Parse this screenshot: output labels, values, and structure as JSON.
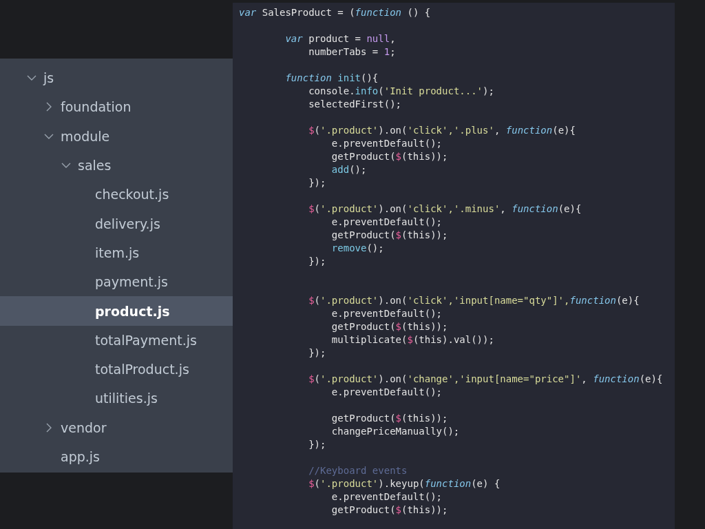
{
  "file_tree": [
    {
      "kind": "folder",
      "name": "js",
      "expanded": true,
      "selected": false,
      "children": [
        {
          "kind": "folder",
          "name": "foundation",
          "expanded": false,
          "selected": false
        },
        {
          "kind": "folder",
          "name": "module",
          "expanded": true,
          "selected": false,
          "children": [
            {
              "kind": "folder",
              "name": "sales",
              "expanded": true,
              "selected": false,
              "children": [
                {
                  "kind": "file",
                  "name": "checkout.js",
                  "selected": false
                },
                {
                  "kind": "file",
                  "name": "delivery.js",
                  "selected": false
                },
                {
                  "kind": "file",
                  "name": "item.js",
                  "selected": false
                },
                {
                  "kind": "file",
                  "name": "payment.js",
                  "selected": false
                },
                {
                  "kind": "file",
                  "name": "product.js",
                  "selected": true
                },
                {
                  "kind": "file",
                  "name": "totalPayment.js",
                  "selected": false
                },
                {
                  "kind": "file",
                  "name": "totalProduct.js",
                  "selected": false
                },
                {
                  "kind": "file",
                  "name": "utilities.js",
                  "selected": false
                }
              ]
            }
          ]
        },
        {
          "kind": "folder",
          "name": "vendor",
          "expanded": false,
          "selected": false
        },
        {
          "kind": "file",
          "name": "app.js",
          "selected": false
        }
      ]
    }
  ],
  "code_lines": [
    {
      "kind": "code",
      "tokens": [
        {
          "kind": "keyword",
          "text": "var"
        },
        {
          "kind": "plain",
          "text": " SalesProduct = ("
        },
        {
          "kind": "keyword",
          "text": "function"
        },
        {
          "kind": "plain",
          "text": " () {"
        }
      ]
    },
    {
      "kind": "blank"
    },
    {
      "kind": "code",
      "tokens": [
        {
          "kind": "keyword",
          "text": "        var"
        },
        {
          "kind": "plain",
          "text": " product = "
        },
        {
          "kind": "literal",
          "text": "null"
        },
        {
          "kind": "plain",
          "text": ","
        }
      ]
    },
    {
      "kind": "code",
      "tokens": [
        {
          "kind": "plain",
          "text": "            numberTabs = "
        },
        {
          "kind": "literal",
          "text": "1"
        },
        {
          "kind": "plain",
          "text": ";"
        }
      ]
    },
    {
      "kind": "blank"
    },
    {
      "kind": "code",
      "tokens": [
        {
          "kind": "keyword",
          "text": "        function"
        },
        {
          "kind": "call",
          "text": " init"
        },
        {
          "kind": "plain",
          "text": "(){"
        }
      ]
    },
    {
      "kind": "code",
      "tokens": [
        {
          "kind": "plain",
          "text": "            console."
        },
        {
          "kind": "call",
          "text": "info"
        },
        {
          "kind": "plain",
          "text": "("
        },
        {
          "kind": "string",
          "text": "'Init product...'"
        },
        {
          "kind": "plain",
          "text": ");"
        }
      ]
    },
    {
      "kind": "code",
      "tokens": [
        {
          "kind": "plain",
          "text": "            selectedFirst();"
        }
      ]
    },
    {
      "kind": "blank"
    },
    {
      "kind": "code",
      "tokens": [
        {
          "kind": "dollar",
          "text": "            $"
        },
        {
          "kind": "plain",
          "text": "("
        },
        {
          "kind": "string",
          "text": "'.product'"
        },
        {
          "kind": "plain",
          "text": ").on("
        },
        {
          "kind": "string",
          "text": "'click',"
        },
        {
          "kind": "string",
          "text": "'.plus'"
        },
        {
          "kind": "plain",
          "text": ", "
        },
        {
          "kind": "keyword",
          "text": "function"
        },
        {
          "kind": "plain",
          "text": "(e){"
        }
      ]
    },
    {
      "kind": "code",
      "tokens": [
        {
          "kind": "plain",
          "text": "                e.preventDefault();"
        }
      ]
    },
    {
      "kind": "code",
      "tokens": [
        {
          "kind": "plain",
          "text": "                getProduct("
        },
        {
          "kind": "dollar",
          "text": "$"
        },
        {
          "kind": "plain",
          "text": "(this));"
        }
      ]
    },
    {
      "kind": "code",
      "tokens": [
        {
          "kind": "call",
          "text": "                add"
        },
        {
          "kind": "plain",
          "text": "();"
        }
      ]
    },
    {
      "kind": "code",
      "tokens": [
        {
          "kind": "plain",
          "text": "            });"
        }
      ]
    },
    {
      "kind": "blank"
    },
    {
      "kind": "code",
      "tokens": [
        {
          "kind": "dollar",
          "text": "            $"
        },
        {
          "kind": "plain",
          "text": "("
        },
        {
          "kind": "string",
          "text": "'.product'"
        },
        {
          "kind": "plain",
          "text": ").on("
        },
        {
          "kind": "string",
          "text": "'click',"
        },
        {
          "kind": "string",
          "text": "'.minus'"
        },
        {
          "kind": "plain",
          "text": ", "
        },
        {
          "kind": "keyword",
          "text": "function"
        },
        {
          "kind": "plain",
          "text": "(e){"
        }
      ]
    },
    {
      "kind": "code",
      "tokens": [
        {
          "kind": "plain",
          "text": "                e.preventDefault();"
        }
      ]
    },
    {
      "kind": "code",
      "tokens": [
        {
          "kind": "plain",
          "text": "                getProduct("
        },
        {
          "kind": "dollar",
          "text": "$"
        },
        {
          "kind": "plain",
          "text": "(this));"
        }
      ]
    },
    {
      "kind": "code",
      "tokens": [
        {
          "kind": "call",
          "text": "                remove"
        },
        {
          "kind": "plain",
          "text": "();"
        }
      ]
    },
    {
      "kind": "code",
      "tokens": [
        {
          "kind": "plain",
          "text": "            });"
        }
      ]
    },
    {
      "kind": "blank"
    },
    {
      "kind": "blank"
    },
    {
      "kind": "code",
      "tokens": [
        {
          "kind": "dollar",
          "text": "            $"
        },
        {
          "kind": "plain",
          "text": "("
        },
        {
          "kind": "string",
          "text": "'.product'"
        },
        {
          "kind": "plain",
          "text": ").on("
        },
        {
          "kind": "string",
          "text": "'click',"
        },
        {
          "kind": "string",
          "text": "'input[name=\"qty\"]',"
        },
        {
          "kind": "keyword",
          "text": "function"
        },
        {
          "kind": "plain",
          "text": "(e){"
        }
      ]
    },
    {
      "kind": "code",
      "tokens": [
        {
          "kind": "plain",
          "text": "                e.preventDefault();"
        }
      ]
    },
    {
      "kind": "code",
      "tokens": [
        {
          "kind": "plain",
          "text": "                getProduct("
        },
        {
          "kind": "dollar",
          "text": "$"
        },
        {
          "kind": "plain",
          "text": "(this));"
        }
      ]
    },
    {
      "kind": "code",
      "tokens": [
        {
          "kind": "plain",
          "text": "                multiplicate("
        },
        {
          "kind": "dollar",
          "text": "$"
        },
        {
          "kind": "plain",
          "text": "(this).val());"
        }
      ]
    },
    {
      "kind": "code",
      "tokens": [
        {
          "kind": "plain",
          "text": "            });"
        }
      ]
    },
    {
      "kind": "blank"
    },
    {
      "kind": "code",
      "tokens": [
        {
          "kind": "dollar",
          "text": "            $"
        },
        {
          "kind": "plain",
          "text": "("
        },
        {
          "kind": "string",
          "text": "'.product'"
        },
        {
          "kind": "plain",
          "text": ").on("
        },
        {
          "kind": "string",
          "text": "'change',"
        },
        {
          "kind": "string",
          "text": "'input[name=\"price\"]'"
        },
        {
          "kind": "plain",
          "text": ", "
        },
        {
          "kind": "keyword",
          "text": "function"
        },
        {
          "kind": "plain",
          "text": "(e){"
        }
      ]
    },
    {
      "kind": "code",
      "tokens": [
        {
          "kind": "plain",
          "text": "                e.preventDefault();"
        }
      ]
    },
    {
      "kind": "blank"
    },
    {
      "kind": "code",
      "tokens": [
        {
          "kind": "plain",
          "text": "                getProduct("
        },
        {
          "kind": "dollar",
          "text": "$"
        },
        {
          "kind": "plain",
          "text": "(this));"
        }
      ]
    },
    {
      "kind": "code",
      "tokens": [
        {
          "kind": "plain",
          "text": "                changePriceManually();"
        }
      ]
    },
    {
      "kind": "code",
      "tokens": [
        {
          "kind": "plain",
          "text": "            });"
        }
      ]
    },
    {
      "kind": "blank"
    },
    {
      "kind": "code",
      "tokens": [
        {
          "kind": "comment",
          "text": "            //Keyboard events"
        }
      ]
    },
    {
      "kind": "code",
      "tokens": [
        {
          "kind": "dollar",
          "text": "            $"
        },
        {
          "kind": "plain",
          "text": "("
        },
        {
          "kind": "string",
          "text": "'.product'"
        },
        {
          "kind": "plain",
          "text": ").keyup("
        },
        {
          "kind": "keyword",
          "text": "function"
        },
        {
          "kind": "plain",
          "text": "(e) {"
        }
      ]
    },
    {
      "kind": "code",
      "tokens": [
        {
          "kind": "plain",
          "text": "                e.preventDefault();"
        }
      ]
    },
    {
      "kind": "code",
      "tokens": [
        {
          "kind": "plain",
          "text": "                getProduct("
        },
        {
          "kind": "dollar",
          "text": "$"
        },
        {
          "kind": "plain",
          "text": "(this));"
        }
      ]
    }
  ]
}
